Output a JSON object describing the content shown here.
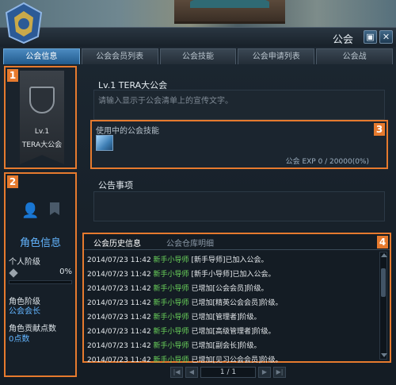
{
  "window": {
    "title": "公会"
  },
  "tabs": [
    {
      "label": "公会信息",
      "active": true
    },
    {
      "label": "公会会员列表",
      "active": false
    },
    {
      "label": "公会技能",
      "active": false
    },
    {
      "label": "公会申请列表",
      "active": false
    },
    {
      "label": "公会战",
      "active": false
    }
  ],
  "banner": {
    "level": "Lv.1",
    "name": "TERA大公会",
    "marker": "1"
  },
  "role": {
    "marker": "2",
    "title": "角色信息",
    "personal_rank_label": "个人阶级",
    "personal_rank_progress": "0%",
    "rank_label": "角色阶级",
    "rank_value": "公会会长",
    "contribution_label": "角色贡献点数",
    "contribution_value": "0点数"
  },
  "guild": {
    "level_name": "Lv.1 TERA大公会",
    "description_placeholder": "请输入显示于公会清单上的宣传文字。"
  },
  "skills": {
    "marker": "3",
    "title": "使用中的公会技能",
    "exp": "公会 EXP 0 / 20000(0%)"
  },
  "notice": {
    "title": "公告事项"
  },
  "history": {
    "marker": "4",
    "tab_history": "公会历史信息",
    "tab_storage": "公会仓库明细",
    "rows": [
      {
        "time": "2014/07/23 11:42",
        "who": "新手小导师",
        "text": "[新手导师]已加入公会。"
      },
      {
        "time": "2014/07/23 11:42",
        "who": "新手小导师",
        "text": "[新手小导师]已加入公会。"
      },
      {
        "time": "2014/07/23 11:42",
        "who": "新手小导师",
        "text": "已增加[公会会员]阶级。"
      },
      {
        "time": "2014/07/23 11:42",
        "who": "新手小导师",
        "text": "已增加[精英公会会员]阶级。"
      },
      {
        "time": "2014/07/23 11:42",
        "who": "新手小导师",
        "text": "已增加[管理者]阶级。"
      },
      {
        "time": "2014/07/23 11:42",
        "who": "新手小导师",
        "text": "已增加[高级管理者]阶级。"
      },
      {
        "time": "2014/07/23 11:42",
        "who": "新手小导师",
        "text": "已增加[副会长]阶级。"
      },
      {
        "time": "2014/07/23 11:42",
        "who": "新手小导师",
        "text": "已增加[见习公会会员]阶级。"
      }
    ]
  },
  "pager": {
    "page": "1 / 1"
  },
  "icons": {
    "lock": "lock-icon",
    "close": "close-icon",
    "person": "person-icon",
    "banner": "banner-icon"
  }
}
